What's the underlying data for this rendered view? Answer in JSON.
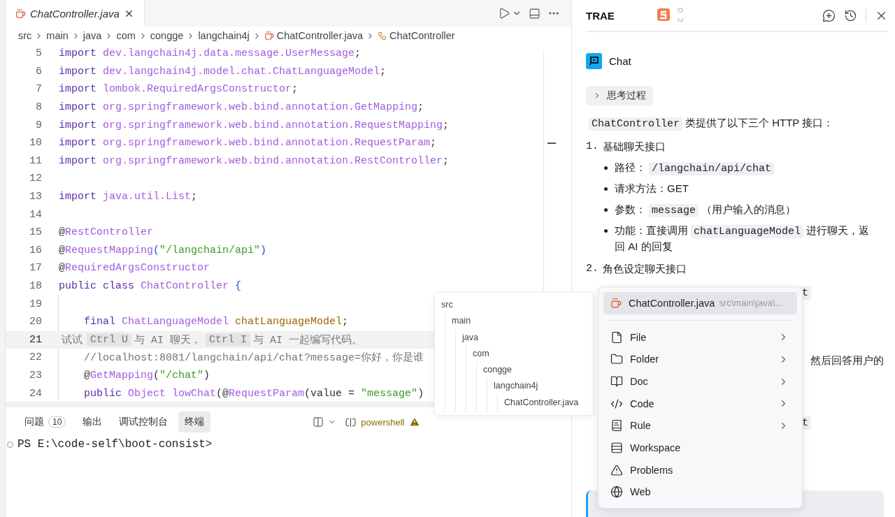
{
  "editor_tab": {
    "title": "ChatController.java",
    "selected": true
  },
  "breadcrumb": [
    {
      "kind": "folder",
      "label": "src"
    },
    {
      "kind": "folder",
      "label": "main"
    },
    {
      "kind": "folder",
      "label": "java"
    },
    {
      "kind": "folder",
      "label": "com"
    },
    {
      "kind": "folder",
      "label": "congge"
    },
    {
      "kind": "folder",
      "label": "langchain4j"
    },
    {
      "kind": "file",
      "label": "ChatController.java"
    },
    {
      "kind": "class",
      "label": "ChatController"
    }
  ],
  "code_lines": [
    {
      "number": "5",
      "selected": false,
      "indented": false,
      "tokens": [
        {
          "kind": "kw",
          "text": "import "
        },
        {
          "kind": "ref",
          "text": "dev.langchain4j.data.message.UserMessage"
        },
        {
          "kind": "punc",
          "text": ";"
        }
      ]
    },
    {
      "number": "6",
      "selected": false,
      "indented": false,
      "tokens": [
        {
          "kind": "kw",
          "text": "import "
        },
        {
          "kind": "ref",
          "text": "dev.langchain4j.model.chat.ChatLanguageModel"
        },
        {
          "kind": "punc",
          "text": ";"
        }
      ]
    },
    {
      "number": "7",
      "selected": false,
      "indented": false,
      "tokens": [
        {
          "kind": "kw",
          "text": "import "
        },
        {
          "kind": "ref",
          "text": "lombok.RequiredArgsConstructor"
        },
        {
          "kind": "punc",
          "text": ";"
        }
      ]
    },
    {
      "number": "8",
      "selected": false,
      "indented": false,
      "tokens": [
        {
          "kind": "kw",
          "text": "import "
        },
        {
          "kind": "ref",
          "text": "org.springframework.web.bind.annotation.GetMapping"
        },
        {
          "kind": "punc",
          "text": ";"
        }
      ]
    },
    {
      "number": "9",
      "selected": false,
      "indented": false,
      "tokens": [
        {
          "kind": "kw",
          "text": "import "
        },
        {
          "kind": "ref",
          "text": "org.springframework.web.bind.annotation.RequestMapping"
        },
        {
          "kind": "punc",
          "text": ";"
        }
      ]
    },
    {
      "number": "10",
      "selected": false,
      "indented": false,
      "tokens": [
        {
          "kind": "kw",
          "text": "import "
        },
        {
          "kind": "ref",
          "text": "org.springframework.web.bind.annotation.RequestParam"
        },
        {
          "kind": "punc",
          "text": ";"
        }
      ]
    },
    {
      "number": "11",
      "selected": false,
      "indented": false,
      "tokens": [
        {
          "kind": "kw",
          "text": "import "
        },
        {
          "kind": "ref",
          "text": "org.springframework.web.bind.annotation.RestController"
        },
        {
          "kind": "punc",
          "text": ";"
        }
      ]
    },
    {
      "number": "12",
      "selected": false,
      "indented": false
    },
    {
      "number": "13",
      "selected": false,
      "indented": false,
      "tokens": [
        {
          "kind": "kw",
          "text": "import "
        },
        {
          "kind": "ref",
          "text": "java.util.List"
        },
        {
          "kind": "punc",
          "text": ";"
        }
      ]
    },
    {
      "number": "14",
      "selected": false,
      "indented": false
    },
    {
      "number": "15",
      "selected": false,
      "indented": false,
      "tokens": [
        {
          "kind": "punc",
          "text": "@"
        },
        {
          "kind": "ref",
          "text": "RestController"
        }
      ]
    },
    {
      "number": "16",
      "selected": false,
      "indented": false,
      "tokens": [
        {
          "kind": "punc",
          "text": "@"
        },
        {
          "kind": "ref",
          "text": "RequestMapping"
        },
        {
          "kind": "brace",
          "text": "("
        },
        {
          "kind": "str",
          "text": "\"/langchain/api\""
        },
        {
          "kind": "brace",
          "text": ")"
        }
      ]
    },
    {
      "number": "17",
      "selected": false,
      "indented": false,
      "tokens": [
        {
          "kind": "punc",
          "text": "@"
        },
        {
          "kind": "ref",
          "text": "RequiredArgsConstructor"
        }
      ]
    },
    {
      "number": "18",
      "selected": false,
      "indented": false,
      "tokens": [
        {
          "kind": "kw",
          "text": "public class "
        },
        {
          "kind": "ref",
          "text": "ChatController "
        },
        {
          "kind": "brace",
          "text": "{"
        }
      ]
    },
    {
      "number": "19",
      "selected": false,
      "indented": true
    },
    {
      "number": "20",
      "selected": false,
      "indented": true,
      "tokens": [
        {
          "kind": "kw",
          "text": "final "
        },
        {
          "kind": "ref",
          "text": "ChatLanguageModel "
        },
        {
          "kind": "field",
          "text": "chatLanguageModel"
        },
        {
          "kind": "punc",
          "text": ";"
        }
      ]
    },
    {
      "number": "21",
      "selected": true,
      "indented": false,
      "tokens": [
        {
          "kind": "hint",
          "text": "试试"
        },
        {
          "kind": "key",
          "text": "Ctrl U"
        },
        {
          "kind": "hint",
          "text": "与 AI 聊天，"
        },
        {
          "kind": "key",
          "text": "Ctrl I"
        },
        {
          "kind": "hint",
          "text": "与 AI 一起编写代码。"
        }
      ]
    },
    {
      "number": "22",
      "selected": false,
      "indented": true,
      "tokens": [
        {
          "kind": "comment",
          "text": "//localhost:8081/langchain/api/chat?message=你好，你是谁"
        }
      ]
    },
    {
      "number": "23",
      "selected": false,
      "indented": true,
      "tokens": [
        {
          "kind": "punc",
          "text": "@"
        },
        {
          "kind": "ref",
          "text": "GetMapping"
        },
        {
          "kind": "punc",
          "text": "("
        },
        {
          "kind": "str",
          "text": "\"/chat\""
        },
        {
          "kind": "punc",
          "text": ")"
        }
      ]
    },
    {
      "number": "24",
      "selected": false,
      "indented": true,
      "tokens": [
        {
          "kind": "kw",
          "text": "public "
        },
        {
          "kind": "ref",
          "text": "Object lowChat"
        },
        {
          "kind": "punc",
          "text": "(@"
        },
        {
          "kind": "ref",
          "text": "RequestParam"
        },
        {
          "kind": "punc",
          "text": "(value = "
        },
        {
          "kind": "str",
          "text": "\"message\""
        },
        {
          "kind": "punc",
          "text": ")"
        }
      ]
    }
  ],
  "bottom_panel": {
    "tabs": [
      {
        "label": "问题",
        "badge": "10",
        "selected": false
      },
      {
        "label": "输出",
        "selected": false
      },
      {
        "label": "调试控制台",
        "selected": false
      },
      {
        "label": "终端",
        "selected": true
      }
    ],
    "shell": "powershell",
    "shell_warning": true,
    "prompt": "PS E:\\code-self\\boot-consist>"
  },
  "assistant": {
    "title": "TRAE",
    "chat_label": "Chat",
    "thinking": {
      "label": "思考过程",
      "expanded": false
    },
    "intro": [
      {
        "kind": "code",
        "text": "ChatController"
      },
      {
        "kind": "text",
        "text": "类提供了以下三个 HTTP 接口："
      }
    ],
    "sections": [
      {
        "number": "1.",
        "title": "基础聊天接口",
        "bullets": [
          [
            {
              "kind": "text",
              "text": "路径："
            },
            {
              "kind": "code",
              "text": "/langchain/api/chat"
            }
          ],
          [
            {
              "kind": "text",
              "text": "请求方法：GET"
            }
          ],
          [
            {
              "kind": "text",
              "text": "参数："
            },
            {
              "kind": "code",
              "text": "message"
            },
            {
              "kind": "text",
              "text": "（用户输入的消息）"
            }
          ],
          [
            {
              "kind": "text",
              "text": "功能：直接调用"
            },
            {
              "kind": "code",
              "text": "chatLanguageModel"
            },
            {
              "kind": "text",
              "text": "进行聊天，返"
            },
            {
              "kind": "newline_text",
              "text": "回 AI 的回复"
            }
          ]
        ]
      },
      {
        "number": "2.",
        "title": "角色设定聊天接口"
      }
    ],
    "partly_hidden": [
      {
        "kind": "code",
        "text": "t"
      },
      {
        "kind": "text",
        "text": "然后回答用户的"
      },
      {
        "kind": "code",
        "text": "t"
      }
    ]
  },
  "path_tree": {
    "label": "src",
    "children": [
      {
        "label": "main",
        "children": [
          {
            "label": "java",
            "children": [
              {
                "label": "com",
                "children": [
                  {
                    "label": "congge",
                    "children": [
                      {
                        "label": "langchain4j",
                        "children": [
                          {
                            "label": "ChatController.java"
                          }
                        ]
                      }
                    ]
                  }
                ]
              }
            ]
          }
        ]
      }
    ]
  },
  "context_menu": {
    "current_file": {
      "name": "ChatController.java",
      "path": "src\\main\\java\\...",
      "selected": true
    },
    "items": [
      {
        "kind": "file",
        "label": "File",
        "submenu": true
      },
      {
        "kind": "folder",
        "label": "Folder",
        "submenu": true
      },
      {
        "kind": "doc",
        "label": "Doc",
        "submenu": true
      },
      {
        "kind": "code",
        "label": "Code",
        "submenu": true
      },
      {
        "kind": "rule",
        "label": "Rule",
        "submenu": true
      },
      {
        "kind": "workspace",
        "label": "Workspace",
        "submenu": false
      },
      {
        "kind": "problems",
        "label": "Problems",
        "submenu": false
      },
      {
        "kind": "web",
        "label": "Web",
        "submenu": false
      }
    ]
  }
}
